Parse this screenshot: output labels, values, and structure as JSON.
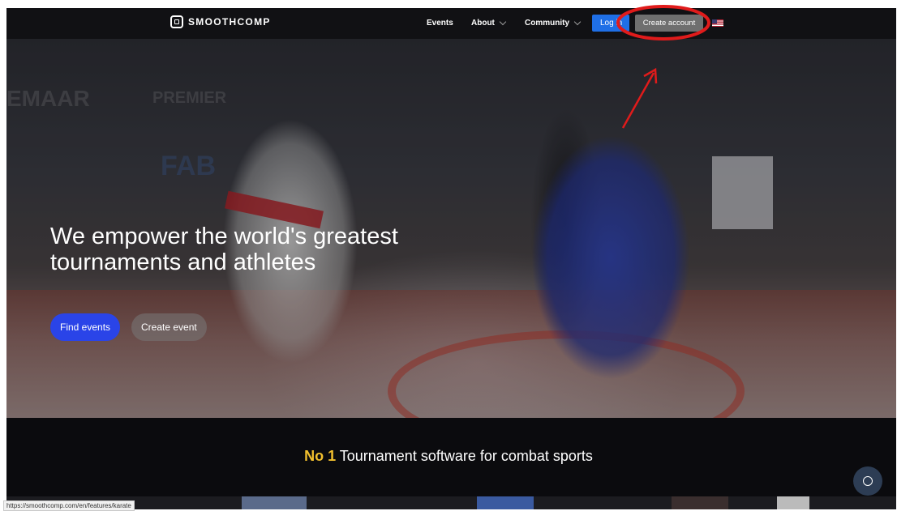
{
  "nav": {
    "logo_text": "SMOOTHCOMP",
    "links": [
      {
        "label": "Events"
      },
      {
        "label": "About"
      },
      {
        "label": "Community"
      }
    ],
    "login_label": "Log in",
    "create_account_label": "Create account",
    "language_icon": "us-flag-icon"
  },
  "hero": {
    "title": "We empower the world's greatest tournaments and athletes",
    "find_events_label": "Find events",
    "create_event_label": "Create event",
    "banner_texts": [
      "EMAAR",
      "PREMIER",
      "FAB"
    ]
  },
  "tagline": {
    "highlight": "No 1",
    "rest": " Tournament software for combat sports"
  },
  "status_bar": {
    "url": "https://smoothcomp.com/en/features/karate"
  },
  "chat": {
    "icon": "chat-bubble-icon"
  },
  "colors": {
    "primary_blue": "#2a44e8",
    "login_blue": "#1f6fe6",
    "highlight_yellow": "#f2c02e",
    "annotation_red": "#e01b1b"
  }
}
